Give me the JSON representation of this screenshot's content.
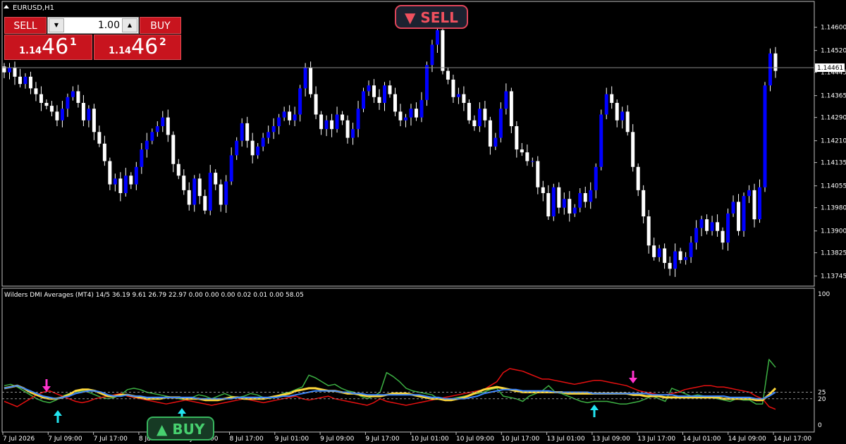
{
  "window": {
    "symbol_title": "EURUSD,H1"
  },
  "trade_panel": {
    "sell_label": "SELL",
    "buy_label": "BUY",
    "lot_value": "1.00",
    "sell_price_prefix": "1.14",
    "sell_price_digits": "46",
    "sell_price_sup": "1",
    "buy_price_prefix": "1.14",
    "buy_price_digits": "46",
    "buy_price_sup": "2"
  },
  "signals": {
    "sell": "▼ SELL",
    "buy": "▲ BUY"
  },
  "colors": {
    "bull_candle": "#0000ff",
    "bear_candle": "#ffffff",
    "di_plus": "#3cb043",
    "di_minus": "#e61010",
    "adx": "#ffd83a",
    "adxr": "#3b86ff",
    "sell_arrow": "#ff33cc",
    "buy_arrow": "#22e4f0"
  },
  "indicator": {
    "header": "Wilders DMI Averages (MT4) 14/5 36.19 9.61 26.79 22.97 0.00 0.00 0.00 0.02 0.01 0.00 58.05"
  },
  "chart_data": [
    {
      "type": "candlestick",
      "title": "EURUSD,H1",
      "current_price_label": "1.14461",
      "current_price": 1.14461,
      "ylim": [
        1.1372,
        1.1465
      ],
      "y_ticks": [
        "1.14600",
        "1.14520",
        "1.14445",
        "1.14365",
        "1.14290",
        "1.14210",
        "1.14135",
        "1.14055",
        "1.13980",
        "1.13900",
        "1.13825",
        "1.13745"
      ],
      "x_ticks": [
        "7 Jul 2026",
        "7 Jul 09:00",
        "7 Jul 17:00",
        "8 Jul 01:00",
        "8 Jul 09:00",
        "8 Jul 17:00",
        "9 Jul 01:00",
        "9 Jul 09:00",
        "9 Jul 17:00",
        "10 Jul 01:00",
        "10 Jul 09:00",
        "10 Jul 17:00",
        "13 Jul 01:00",
        "13 Jul 09:00",
        "13 Jul 17:00",
        "14 Jul 01:00",
        "14 Jul 09:00",
        "14 Jul 17:00"
      ],
      "closes": [
        1.14445,
        1.1446,
        1.1443,
        1.14405,
        1.1443,
        1.1439,
        1.1437,
        1.1434,
        1.1433,
        1.1431,
        1.1428,
        1.1432,
        1.1436,
        1.1438,
        1.1434,
        1.1428,
        1.1432,
        1.1424,
        1.142,
        1.1414,
        1.1406,
        1.1408,
        1.1403,
        1.1409,
        1.1406,
        1.1412,
        1.1418,
        1.1421,
        1.1424,
        1.1426,
        1.1429,
        1.1423,
        1.1413,
        1.1409,
        1.1404,
        1.1399,
        1.1408,
        1.1402,
        1.1397,
        1.141,
        1.1406,
        1.1399,
        1.1407,
        1.1416,
        1.1421,
        1.1427,
        1.1421,
        1.1416,
        1.1419,
        1.1422,
        1.1424,
        1.1426,
        1.1429,
        1.1431,
        1.1428,
        1.143,
        1.1439,
        1.1446,
        1.1437,
        1.143,
        1.1425,
        1.1428,
        1.1425,
        1.143,
        1.1428,
        1.1422,
        1.1425,
        1.1432,
        1.1438,
        1.144,
        1.1436,
        1.1434,
        1.144,
        1.1437,
        1.1431,
        1.1428,
        1.1429,
        1.1432,
        1.1429,
        1.1435,
        1.1447,
        1.1454,
        1.1459,
        1.1445,
        1.1442,
        1.1436,
        1.1437,
        1.1434,
        1.1428,
        1.1426,
        1.1432,
        1.1428,
        1.1419,
        1.1422,
        1.1432,
        1.1438,
        1.1426,
        1.1418,
        1.1417,
        1.1414,
        1.1414,
        1.1405,
        1.1403,
        1.1395,
        1.1405,
        1.1398,
        1.1401,
        1.1396,
        1.1398,
        1.1403,
        1.14,
        1.1404,
        1.1412,
        1.143,
        1.1437,
        1.1434,
        1.1428,
        1.1431,
        1.1424,
        1.1412,
        1.1404,
        1.1395,
        1.1385,
        1.1381,
        1.1384,
        1.1379,
        1.1377,
        1.1383,
        1.138,
        1.1381,
        1.1386,
        1.1391,
        1.1394,
        1.139,
        1.1393,
        1.139,
        1.1386,
        1.1396,
        1.14,
        1.139,
        1.1402,
        1.1404,
        1.1394,
        1.1405,
        1.144,
        1.1451,
        1.1445
      ],
      "open_offsets": []
    },
    {
      "type": "line",
      "title": "Wilders DMI Averages (MT4) 14/5",
      "ylim": [
        0,
        100
      ],
      "y_ticks": [
        "100",
        "25",
        "20",
        "0"
      ],
      "levels": [
        25,
        20
      ],
      "series": [
        {
          "name": "",
          "values": [
            30,
            31,
            29,
            26,
            23,
            20,
            18,
            17,
            19,
            22,
            24,
            25,
            26,
            25,
            23,
            21,
            20,
            21,
            23,
            27,
            28,
            27,
            25,
            24,
            23,
            22,
            21,
            20,
            19,
            21,
            23,
            22,
            20,
            22,
            24,
            22,
            21,
            22,
            24,
            23,
            21,
            20,
            22,
            24,
            25,
            27,
            29,
            38,
            36,
            33,
            30,
            31,
            28,
            26,
            25,
            22,
            20,
            22,
            25,
            40,
            37,
            33,
            28,
            26,
            25,
            24,
            23,
            20,
            19,
            20,
            21,
            22,
            23,
            24,
            25,
            27,
            28,
            22,
            21,
            20,
            18,
            22,
            24,
            26,
            30,
            25,
            24,
            22,
            20,
            18,
            17,
            18,
            18,
            18,
            17,
            16,
            16,
            17,
            18,
            20,
            22,
            20,
            18,
            28,
            26,
            24,
            22,
            23,
            22,
            21,
            20,
            19,
            18,
            20,
            19,
            19,
            16,
            16,
            50,
            44
          ]
        },
        {
          "name": "",
          "values": [
            18,
            16,
            14,
            17,
            20,
            23,
            25,
            26,
            24,
            22,
            20,
            18,
            17,
            18,
            20,
            21,
            22,
            23,
            24,
            22,
            21,
            20,
            19,
            18,
            17,
            16,
            17,
            18,
            19,
            18,
            17,
            16,
            15,
            16,
            17,
            18,
            19,
            20,
            19,
            18,
            17,
            18,
            19,
            20,
            21,
            22,
            20,
            19,
            20,
            21,
            22,
            20,
            19,
            18,
            17,
            16,
            15,
            17,
            20,
            18,
            17,
            16,
            15,
            16,
            17,
            18,
            19,
            20,
            21,
            22,
            23,
            24,
            25,
            26,
            27,
            30,
            33,
            40,
            43,
            42,
            41,
            39,
            37,
            35,
            35,
            34,
            33,
            32,
            31,
            32,
            33,
            34,
            34,
            33,
            32,
            31,
            30,
            28,
            26,
            25,
            24,
            23,
            23,
            24,
            25,
            27,
            28,
            29,
            30,
            30,
            29,
            29,
            28,
            27,
            26,
            25,
            22,
            20,
            14,
            12
          ]
        },
        {
          "name": "",
          "values": [
            28,
            29,
            30,
            28,
            25,
            23,
            21,
            20,
            20,
            21,
            23,
            26,
            27,
            27,
            26,
            24,
            22,
            22,
            23,
            23,
            22,
            21,
            20,
            20,
            20,
            21,
            21,
            21,
            20,
            20,
            20,
            19,
            19,
            19,
            20,
            21,
            21,
            20,
            20,
            20,
            20,
            21,
            22,
            23,
            24,
            26,
            27,
            28,
            28,
            27,
            26,
            26,
            25,
            24,
            24,
            23,
            22,
            22,
            22,
            23,
            24,
            24,
            24,
            23,
            22,
            21,
            20,
            20,
            19,
            19,
            20,
            21,
            23,
            25,
            27,
            28,
            29,
            28,
            27,
            26,
            25,
            25,
            25,
            25,
            25,
            25,
            25,
            24,
            24,
            24,
            24,
            24,
            24,
            24,
            24,
            24,
            24,
            23,
            23,
            22,
            22,
            22,
            21,
            21,
            21,
            21,
            21,
            21,
            21,
            21,
            21,
            20,
            20,
            20,
            20,
            20,
            19,
            19,
            23,
            28
          ]
        },
        {
          "name": "",
          "values": [
            28,
            29,
            30,
            28,
            26,
            24,
            22,
            21,
            20,
            21,
            22,
            24,
            25,
            26,
            26,
            25,
            23,
            22,
            22,
            23,
            22,
            22,
            21,
            21,
            21,
            21,
            21,
            21,
            21,
            21,
            20,
            20,
            20,
            20,
            20,
            20,
            21,
            21,
            21,
            21,
            21,
            21,
            21,
            22,
            22,
            23,
            24,
            25,
            26,
            26,
            26,
            26,
            25,
            25,
            24,
            24,
            23,
            23,
            23,
            23,
            23,
            23,
            23,
            23,
            23,
            22,
            21,
            21,
            20,
            20,
            20,
            20,
            21,
            22,
            24,
            25,
            26,
            27,
            27,
            27,
            26,
            26,
            26,
            26,
            26,
            25,
            25,
            25,
            25,
            25,
            25,
            24,
            24,
            24,
            24,
            24,
            24,
            24,
            24,
            24,
            23,
            23,
            23,
            23,
            22,
            22,
            22,
            22,
            22,
            22,
            22,
            22,
            21,
            21,
            21,
            21,
            20,
            20,
            22,
            25
          ]
        }
      ]
    }
  ]
}
